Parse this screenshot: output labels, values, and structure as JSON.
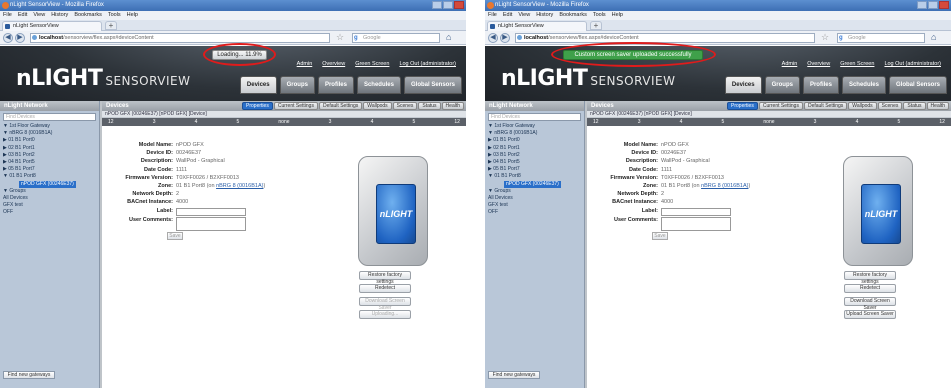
{
  "browser": {
    "window_title": "nLight SensorView - Mozilla Firefox",
    "menu": [
      "File",
      "Edit",
      "View",
      "History",
      "Bookmarks",
      "Tools",
      "Help"
    ],
    "tab_title": "nLight SensorView",
    "new_tab": "+",
    "url_host": "localhost",
    "url_path": "/sensorview/flex.aspx#deviceContent",
    "search_placeholder": "Google",
    "back": "◀",
    "forward": "▶",
    "star": "☆",
    "home": "⌂"
  },
  "app": {
    "logo": "nLIGHT",
    "logo_sub": "SENSORVIEW",
    "top_links": [
      "Admin",
      "Overview",
      "Green Screen",
      "Log Out (administrator)"
    ],
    "main_tabs": [
      "Devices",
      "Groups",
      "Profiles",
      "Schedules",
      "Global Sensors"
    ],
    "left_header": "nLight Network",
    "find_placeholder": "Find Devices",
    "tree": [
      "▼ 1st Floor Gateway",
      "  ▼ nBRG 8 (0016B1A)",
      "    ▶ 01 B1 Port0",
      "    ▶ 02 B1 Port1",
      "    ▶ 03 B1 Port2",
      "    ▶ 04 B1 Port5",
      "    ▶ 05 B1 Port7",
      "    ▼ 01 B1 Port8"
    ],
    "selected_device": "nPOD GFX (00246E37)",
    "groups_tree": [
      "▼ Groups",
      "  All Devices",
      "  GFX test",
      "  OFF"
    ],
    "find_gateways": "Find new gateways",
    "devices_header": "Devices",
    "sub_tabs": [
      "Properties",
      "Current Settings",
      "Default Settings",
      "Wallpods",
      "Scenes",
      "Status",
      "Health"
    ],
    "device_bar": "nPOD GFX (00246E37) [nPOD GFX] [Device]",
    "channels": [
      "12",
      "3",
      "4",
      "5",
      "none",
      "3",
      "4",
      "5",
      "12"
    ],
    "properties": [
      {
        "k": "Model Name:",
        "v": "nPOD GFX"
      },
      {
        "k": "Device ID:",
        "v": "00246E37"
      },
      {
        "k": "Description:",
        "v": "WallPod - Graphical"
      },
      {
        "k": "Date Code:",
        "v": "1111"
      },
      {
        "k": "Firmware Version:",
        "v": "T0XFF0026 / B2XFF0013"
      },
      {
        "k": "Zone:",
        "v": "01 B1 Port8 (on ",
        "link": "nBRG 8 (0016B1A)",
        "tail": ")"
      },
      {
        "k": "Network Depth:",
        "v": "2"
      },
      {
        "k": "BACnet Instance:",
        "v": "4000"
      }
    ],
    "label_field": "Label:",
    "comments_field": "User Comments:",
    "save_label": "Save",
    "device_screen_text": "nLIGHT"
  },
  "left": {
    "status_toast": "Loading... 11.9%",
    "side_buttons": [
      {
        "label": "Restore factory settings",
        "enabled": true
      },
      {
        "label": "Redetect",
        "enabled": true
      },
      {
        "label": "Download Screen Saver",
        "enabled": false
      },
      {
        "label": "Uploading...",
        "enabled": false
      }
    ]
  },
  "right": {
    "status_toast": "Custom screen saver uploaded successfully",
    "side_buttons": [
      {
        "label": "Restore factory settings",
        "enabled": true
      },
      {
        "label": "Redetect",
        "enabled": true
      },
      {
        "label": "Download Screen Saver",
        "enabled": true
      },
      {
        "label": "Upload Screen Saver",
        "enabled": true
      }
    ]
  },
  "colors": {
    "highlight_ellipse": "#e01b1b",
    "success_toast": "#3fa04a",
    "selected": "#2a6fc9"
  }
}
